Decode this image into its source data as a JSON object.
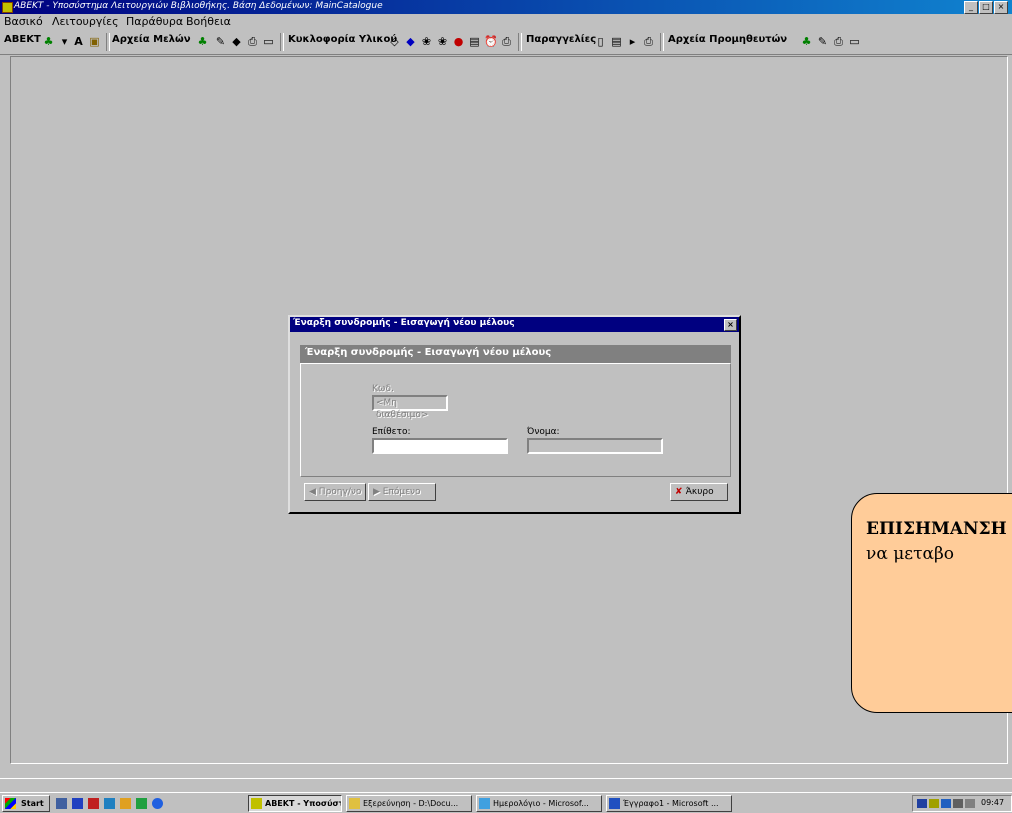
{
  "window": {
    "title": "ΑΒΕΚΤ - Υποσύστημα Λειτουργιών Βιβλιοθήκης. Βάση Δεδομένων: MainCatalogue",
    "controls": [
      "_",
      "□",
      "×"
    ]
  },
  "menu": [
    "Βασικό",
    "Λειτουργίες",
    "Παράθυρα",
    "Βοήθεια"
  ],
  "toolbar": {
    "groups": [
      "ΑΒΕΚΤ",
      "Αρχεία Μελών",
      "Κυκλοφορία Υλικού",
      "Παραγγελίες",
      "Αρχεία Προμηθευτών"
    ]
  },
  "dialog": {
    "title": "Έναρξη συνδρομής - Εισαγωγή νέου μέλους",
    "header": "Έναρξη συνδρομής - Εισαγωγή νέου μέλους",
    "close": "×",
    "code_label": "Κωδ.",
    "code_value": "<Μη διαθέσιμο>",
    "surname_label": "Επίθετο:",
    "surname_value": "",
    "name_label": "Όνομα:",
    "name_value": "",
    "prev_button": "Προηγ/νο",
    "next_button": "Επόμενο",
    "cancel_button": "Άκυρο"
  },
  "callout": {
    "line1": "ΕΠΙΣΗΜΑΝΣΗ",
    "line2": "να μεταβο"
  },
  "taskbar": {
    "start": "Start",
    "tasks": [
      {
        "label": "ΑΒΕΚΤ - Υποσύστημ...",
        "active": true
      },
      {
        "label": "Εξερεύνηση - D:\\Docu...",
        "active": false
      },
      {
        "label": "Ημερολόγιο - Microsof...",
        "active": false
      },
      {
        "label": "Έγγραφο1 - Microsoft ...",
        "active": false
      }
    ],
    "clock": "09:47"
  },
  "colors": {
    "titlebar": "#000080",
    "callout_bg": "#ffcc99",
    "desktop": "#c0c0c0"
  }
}
